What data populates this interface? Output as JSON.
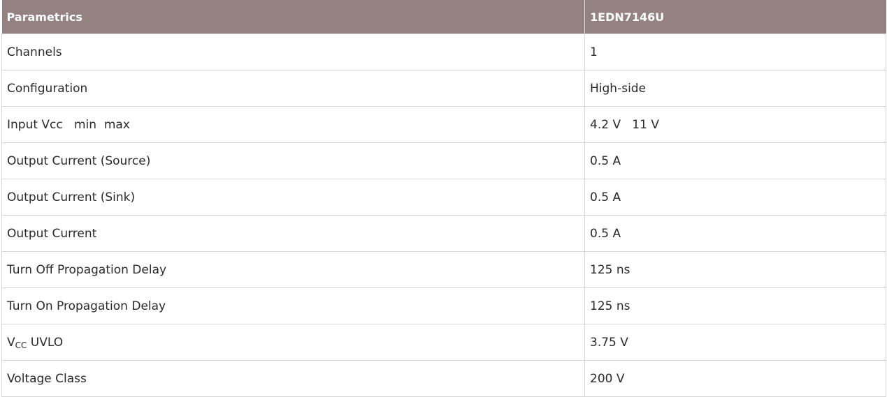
{
  "table": {
    "header": {
      "col1": "Parametrics",
      "col2": "1EDN7146U"
    },
    "rows": [
      {
        "param": "Channels",
        "value": "1"
      },
      {
        "param": "Configuration",
        "value": "High-side"
      },
      {
        "param": "Input Vcc   min  max",
        "value": "4.2 V   11 V"
      },
      {
        "param": "Output Current (Source)",
        "value": "0.5 A"
      },
      {
        "param": "Output Current (Sink)",
        "value": "0.5 A"
      },
      {
        "param": "Output Current",
        "value": "0.5 A"
      },
      {
        "param": "Turn Off Propagation Delay",
        "value": "125 ns"
      },
      {
        "param": "Turn On Propagation Delay",
        "value": "125 ns"
      },
      {
        "param_main": "V",
        "param_sub": "CC",
        "param_rest": " UVLO",
        "value": "3.75 V"
      },
      {
        "param": "Voltage Class",
        "value": "200 V"
      }
    ]
  }
}
